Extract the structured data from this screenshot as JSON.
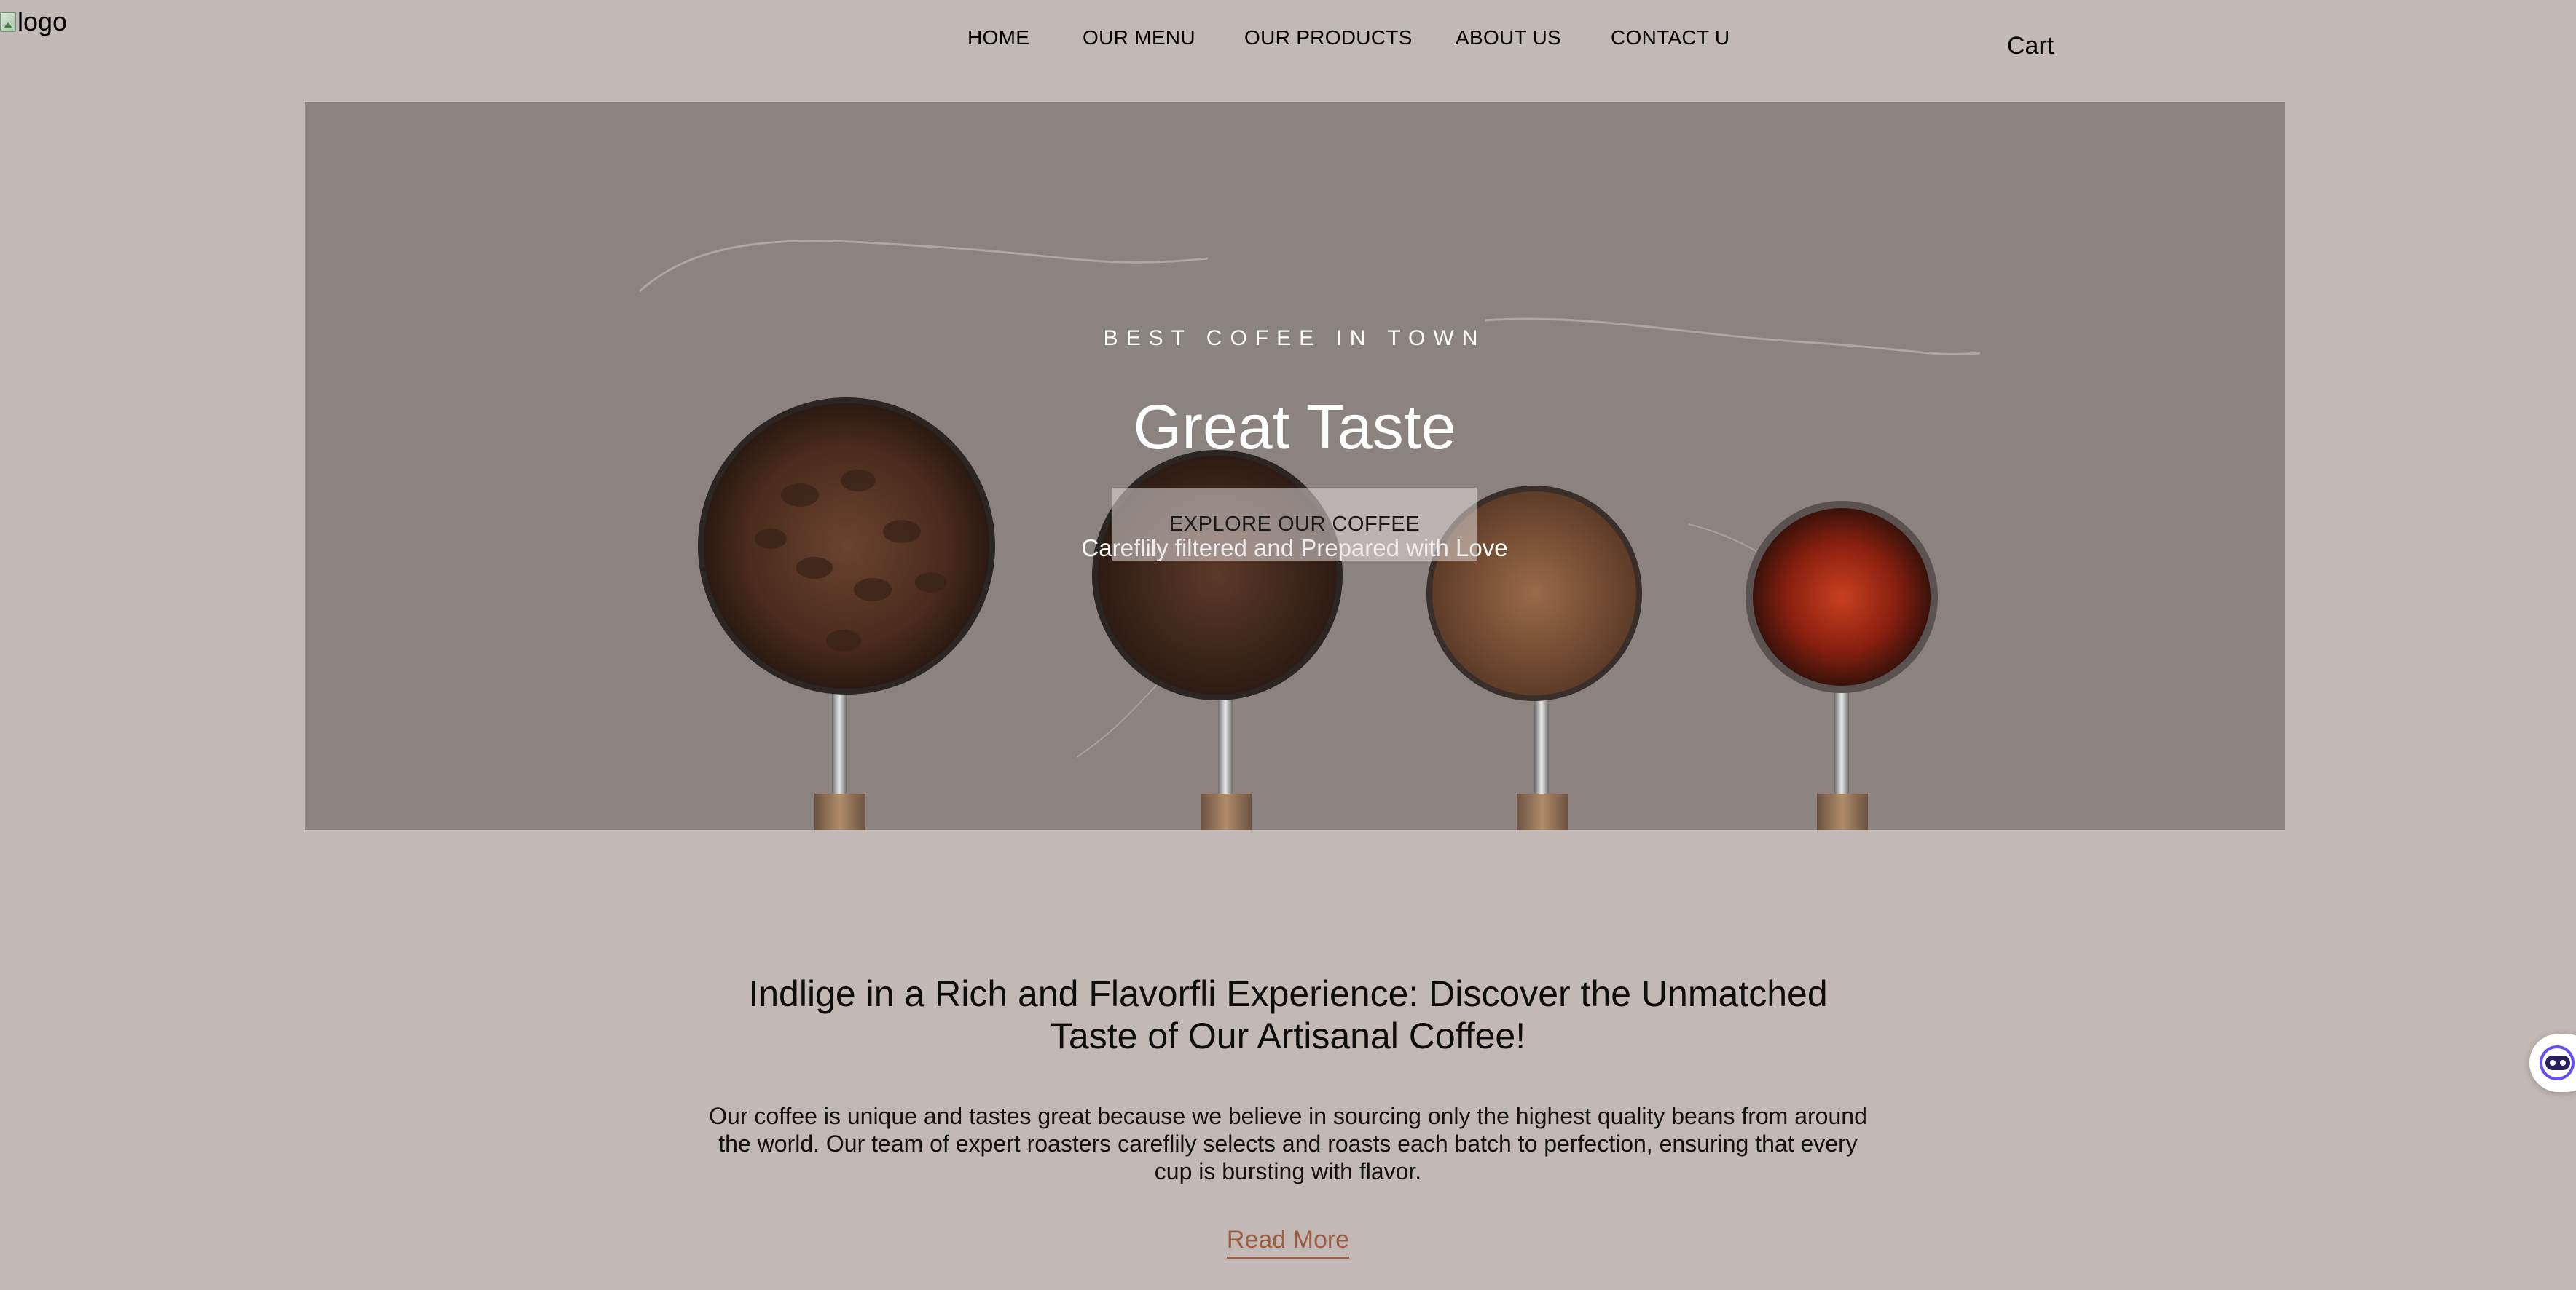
{
  "header": {
    "logo_alt": "logo",
    "nav": [
      {
        "label": "HOME"
      },
      {
        "label": "OUR MENU"
      },
      {
        "label": "OUR PRODUCTS"
      },
      {
        "label": "ABOUT US"
      },
      {
        "label": "CONTACT U"
      }
    ],
    "cart_label": "Cart"
  },
  "hero": {
    "eyebrow": "BEST COFEE IN TOWN",
    "title": "Great Taste",
    "subtitle": "Careflily filtered and Prepared with Love",
    "cta_label": "EXPLORE OUR COFFEE",
    "background_color": "#8c827f"
  },
  "intro": {
    "headline_line1": "Indlige in a Rich and Flavorfli Experience: Discover the Unmatched",
    "headline_line2": "Taste of Our Artisanal Coffee!",
    "body_line1": "Our coffee is unique and tastes great because we believe in sourcing only the highest quality beans from around",
    "body_line2": "the world. Our team of expert roasters careflily selects and roasts each batch to perfection, ensuring that every",
    "body_line3": "cup is bursting with flavor.",
    "read_more_label": "Read More"
  },
  "colors": {
    "page_background": "#c2b8b5",
    "link_accent": "#9b5e43"
  },
  "icons": {
    "logo": "broken-image-icon",
    "chat": "chat-bot-icon"
  }
}
